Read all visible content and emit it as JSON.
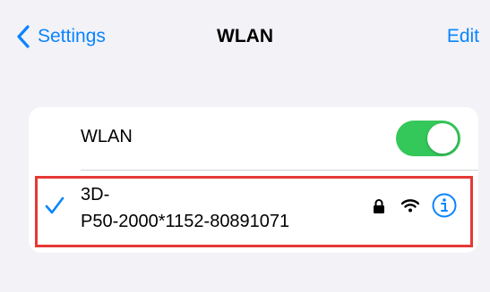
{
  "nav": {
    "back_label": "Settings",
    "title": "WLAN",
    "edit_label": "Edit"
  },
  "wlan": {
    "label": "WLAN",
    "enabled": true
  },
  "network": {
    "name": "3D-\nP50-2000*1152-80891071",
    "connected": true,
    "secured": true,
    "icons": [
      "checkmark-icon",
      "lock-icon",
      "wifi-icon",
      "info-icon"
    ]
  },
  "colors": {
    "accent": "#0a84ff",
    "toggle_on": "#34c759",
    "highlight_border": "#e53935",
    "background": "#f2f2f7"
  }
}
